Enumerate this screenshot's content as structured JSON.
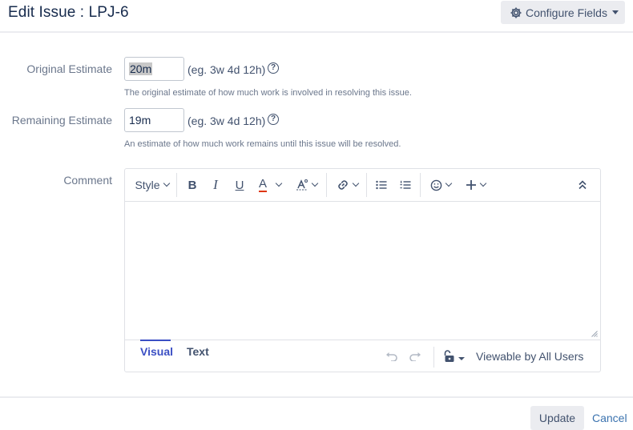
{
  "dialog": {
    "title": "Edit Issue : LPJ-6",
    "configure_fields_label": "Configure Fields"
  },
  "fields": {
    "original_estimate": {
      "label": "Original Estimate",
      "value": "20m",
      "format_hint": "(eg. 3w 4d 12h)",
      "description": "The original estimate of how much work is involved in resolving this issue."
    },
    "remaining_estimate": {
      "label": "Remaining Estimate",
      "value": "19m",
      "format_hint": "(eg. 3w 4d 12h)",
      "description": "An estimate of how much work remains until this issue will be resolved."
    },
    "comment": {
      "label": "Comment"
    }
  },
  "editor": {
    "style_label": "Style",
    "bold_label": "B",
    "italic_label": "I",
    "underline_label": "U",
    "text_color_label": "A",
    "modes": [
      "Visual",
      "Text"
    ],
    "active_mode": "Visual",
    "visibility_label": "Viewable by All Users",
    "text_color_accent": "#de350b"
  },
  "actions": {
    "update_label": "Update",
    "cancel_label": "Cancel"
  },
  "icons": {
    "configure": "gear-icon",
    "help": "question-circle-icon",
    "link": "link-icon",
    "bullet_list": "bullet-list-icon",
    "numbered_list": "numbered-list-icon",
    "emoji": "smiley-icon",
    "insert": "plus-icon",
    "collapse": "double-chevron-up-icon",
    "undo": "undo-icon",
    "redo": "redo-icon",
    "visibility": "unlock-icon"
  },
  "colors": {
    "accent": "#3b4fc4",
    "link": "#3b73af",
    "button_bg": "#ebecf0"
  }
}
